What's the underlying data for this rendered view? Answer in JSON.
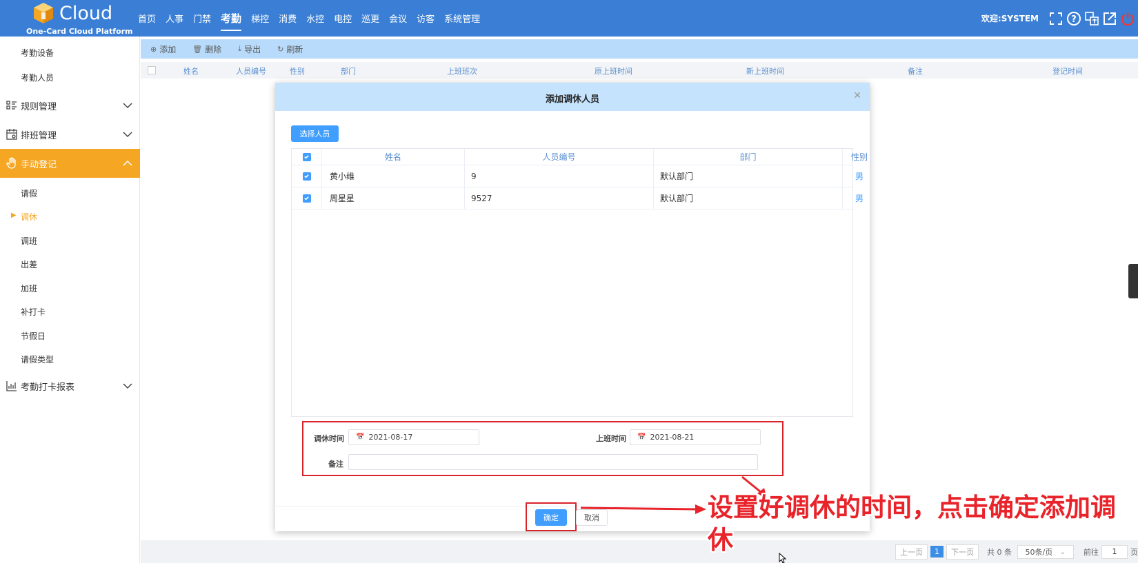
{
  "header": {
    "brand": "Cloud",
    "subtitle": "One-Card Cloud Platform",
    "nav": [
      "首页",
      "人事",
      "门禁",
      "考勤",
      "梯控",
      "消费",
      "水控",
      "电控",
      "巡更",
      "会议",
      "访客",
      "系统管理"
    ],
    "active_nav": "考勤",
    "welcome": "欢迎:SYSTEM",
    "icons": [
      "fullscreen-icon",
      "help-icon",
      "language-icon",
      "external-link-icon",
      "power-icon"
    ]
  },
  "sidebar": {
    "top_items": [
      "考勤设备",
      "考勤人员"
    ],
    "groups": [
      {
        "label": "规则管理",
        "icon": "rules-icon",
        "expanded": false
      },
      {
        "label": "排班管理",
        "icon": "calendar-icon",
        "expanded": false
      },
      {
        "label": "手动登记",
        "icon": "hand-icon",
        "expanded": true
      }
    ],
    "manual_items": [
      "请假",
      "调休",
      "调班",
      "出差",
      "加班",
      "补打卡",
      "节假日",
      "请假类型"
    ],
    "active_item": "调休",
    "report_group": "考勤打卡报表",
    "active_color": "#f5a623"
  },
  "toolbar": {
    "buttons": [
      {
        "label": "添加",
        "icon": "add-icon"
      },
      {
        "label": "删除",
        "icon": "delete-icon"
      },
      {
        "label": "导出",
        "icon": "export-icon"
      },
      {
        "label": "刷新",
        "icon": "refresh-icon"
      }
    ]
  },
  "grid": {
    "columns": [
      "姓名",
      "人员编号",
      "性别",
      "部门",
      "上班班次",
      "原上班时间",
      "新上班时间",
      "备注",
      "登记时间"
    ]
  },
  "pager": {
    "prev": "上一页",
    "current": "1",
    "next": "下一页",
    "total": "共 0 条",
    "page_size": "50条/页",
    "goto": "前往",
    "goto_value": "1",
    "page_suffix": "页"
  },
  "modal": {
    "title": "添加调休人员",
    "select_button": "选择人员",
    "columns": [
      "姓名",
      "人员编号",
      "部门",
      "性别"
    ],
    "rows": [
      {
        "name": "黄小维",
        "id": "9",
        "dept": "默认部门",
        "sex": "男",
        "checked": true
      },
      {
        "name": "周星星",
        "id": "9527",
        "dept": "默认部门",
        "sex": "男",
        "checked": true
      }
    ],
    "form": {
      "rest_time_label": "调休时间",
      "rest_time_value": "2021-08-17",
      "work_time_label": "上班时间",
      "work_time_value": "2021-08-21",
      "remark_label": "备注",
      "remark_value": ""
    },
    "ok_button": "确定",
    "cancel_button": "取消"
  },
  "annotation": {
    "text": "设置好调休的时间，点击确定添加调休",
    "color": "#e8232a"
  }
}
